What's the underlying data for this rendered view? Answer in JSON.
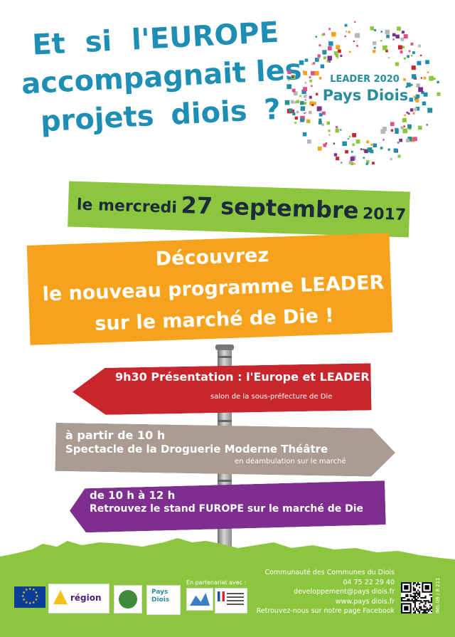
{
  "headline": {
    "line1": "Et si l'EUROPE",
    "line2": "accompagnait les",
    "line3": "projets diois ?"
  },
  "logo": {
    "small": "LEADER 2020",
    "big": "Pays Diois"
  },
  "date_banner": {
    "prefix": "le mercredi",
    "date": "27 septembre",
    "year": "2017"
  },
  "announce": {
    "line1": "Découvrez",
    "line2": "le nouveau programme LEADER",
    "line3": "sur le marché de Die !"
  },
  "signs": {
    "first": {
      "main": "9h30 Présentation : l'Europe et LEADER",
      "sub": "salon de la sous-préfecture de Die"
    },
    "second": {
      "line1": "à partir de 10 h",
      "line2": "Spectacle de la Droguerie Moderne Théâtre",
      "sub": "en déambulation sur le marché"
    },
    "third": {
      "line1": "de 10 h à 12 h",
      "line2": "Retrouvez le stand FUROPE sur le marché de Die"
    }
  },
  "footer": {
    "partner_note": "En partenariat avec :",
    "contact": {
      "org": "Communauté des Communes du Diois",
      "phone": "04 75 22 29 40",
      "email": "developpement@pays diois.fr",
      "web": "www.pays diois.fr",
      "facebook": "Retrouvez-nous sur notre page Facebook"
    },
    "region_text": "région",
    "pays_logo_text": "Pays Diois",
    "reference": "IMS 09 / 8 211"
  },
  "colors": {
    "headline": "#1f8eb5",
    "green": "#8cc63f",
    "orange": "#f6a21c",
    "red_sign": "#c9252c",
    "taupe_sign": "#aa9c93",
    "purple_sign": "#7d2e8e"
  }
}
